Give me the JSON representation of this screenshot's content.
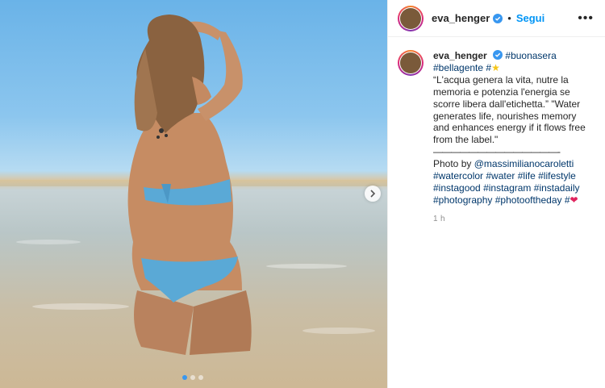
{
  "post": {
    "image_alt": "Woman in blue bikini standing in shallow sea water",
    "carousel": {
      "slides": 3,
      "active": 1
    }
  },
  "header": {
    "username": "eva_henger",
    "separator": "•",
    "follow_label": "Segui",
    "more_label": "•••"
  },
  "caption": {
    "username": "eva_henger",
    "tag1": "#buonasera",
    "tag2": "#bellagente",
    "tag3": "#",
    "line1": "“L'acqua genera la vita, nutre la memoria e potenzia l'energia se scorre libera dall'etichetta.” \"Water generates life, nourishes memory and enhances energy if it flows free from the label.\"",
    "rule": "——————————————-",
    "photo_by": "Photo by",
    "mention": "@massimilianocaroletti",
    "hashtags": [
      "#watercolor",
      "#water",
      "#life",
      "#lifestyle",
      "#instagood",
      "#instagram",
      "#instadaily",
      "#photography",
      "#photooftheday",
      "#"
    ]
  },
  "timestamp": "1 h",
  "colors": {
    "link": "#00376b",
    "follow": "#0095f6",
    "verified": "#3897f0"
  }
}
